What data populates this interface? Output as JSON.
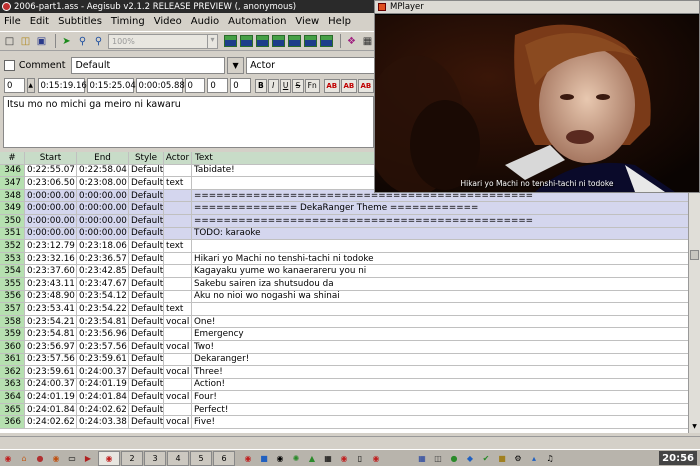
{
  "window": {
    "title": "2006-part1.ass - Aegisub v2.1.2 RELEASE PREVIEW (, anonymous)"
  },
  "menu": [
    "File",
    "Edit",
    "Subtitles",
    "Timing",
    "Video",
    "Audio",
    "Automation",
    "View",
    "Help"
  ],
  "toolbar": {
    "zoom_value": "100%"
  },
  "editor": {
    "comment_label": "Comment",
    "style_value": "Default",
    "actor_value": "Actor",
    "layer": "0",
    "start_time": "0:15:19.16",
    "end_time": "0:15:25.04",
    "duration": "0:00:05.88",
    "margin_l": "0",
    "margin_r": "0",
    "margin_v": "0",
    "fmt": {
      "bold": "B",
      "italic": "I",
      "underline": "U",
      "strike": "S",
      "font": "Fn",
      "c1": "AB",
      "c2": "AB",
      "c3": "AB"
    },
    "text": "Itsu mo no michi ga meiro ni kawaru"
  },
  "grid": {
    "headers": {
      "num": "#",
      "start": "Start",
      "end": "End",
      "style": "Style",
      "actor": "Actor",
      "text": "Text"
    },
    "rows": [
      {
        "num": "346",
        "start": "0:22:55.07",
        "end": "0:22:58.04",
        "style": "Default",
        "actor": "",
        "text": "Tabidate!",
        "comment": false
      },
      {
        "num": "347",
        "start": "0:23:06.50",
        "end": "0:23:08.00",
        "style": "Default",
        "actor": "text",
        "text": "",
        "comment": false
      },
      {
        "num": "348",
        "start": "0:00:00.00",
        "end": "0:00:00.00",
        "style": "Default",
        "actor": "",
        "text": "==============================================",
        "comment": true
      },
      {
        "num": "349",
        "start": "0:00:00.00",
        "end": "0:00:00.00",
        "style": "Default",
        "actor": "",
        "text": "============== DekaRanger Theme ============",
        "comment": true
      },
      {
        "num": "350",
        "start": "0:00:00.00",
        "end": "0:00:00.00",
        "style": "Default",
        "actor": "",
        "text": "==============================================",
        "comment": true
      },
      {
        "num": "351",
        "start": "0:00:00.00",
        "end": "0:00:00.00",
        "style": "Default",
        "actor": "",
        "text": "TODO: karaoke",
        "comment": true
      },
      {
        "num": "352",
        "start": "0:23:12.79",
        "end": "0:23:18.06",
        "style": "Default",
        "actor": "text",
        "text": "",
        "comment": false
      },
      {
        "num": "353",
        "start": "0:23:32.16",
        "end": "0:23:36.57",
        "style": "Default",
        "actor": "",
        "text": "Hikari yo Machi no tenshi-tachi ni todoke",
        "comment": false
      },
      {
        "num": "354",
        "start": "0:23:37.60",
        "end": "0:23:42.85",
        "style": "Default",
        "actor": "",
        "text": "Kagayaku yume wo kanaerareru you ni",
        "comment": false
      },
      {
        "num": "355",
        "start": "0:23:43.11",
        "end": "0:23:47.67",
        "style": "Default",
        "actor": "",
        "text": "Sakebu sairen iza shutsudou da",
        "comment": false
      },
      {
        "num": "356",
        "start": "0:23:48.90",
        "end": "0:23:54.12",
        "style": "Default",
        "actor": "",
        "text": "Aku no nioi wo nogashi wa shinai",
        "comment": false
      },
      {
        "num": "357",
        "start": "0:23:53.41",
        "end": "0:23:54.22",
        "style": "Default",
        "actor": "text",
        "text": "",
        "comment": false
      },
      {
        "num": "358",
        "start": "0:23:54.21",
        "end": "0:23:54.81",
        "style": "Default",
        "actor": "vocal",
        "text": "One!",
        "comment": false
      },
      {
        "num": "359",
        "start": "0:23:54.81",
        "end": "0:23:56.96",
        "style": "Default",
        "actor": "",
        "text": "Emergency",
        "comment": false
      },
      {
        "num": "360",
        "start": "0:23:56.97",
        "end": "0:23:57.56",
        "style": "Default",
        "actor": "vocal",
        "text": "Two!",
        "comment": false
      },
      {
        "num": "361",
        "start": "0:23:57.56",
        "end": "0:23:59.61",
        "style": "Default",
        "actor": "",
        "text": "Dekaranger!",
        "comment": false
      },
      {
        "num": "362",
        "start": "0:23:59.61",
        "end": "0:24:00.37",
        "style": "Default",
        "actor": "vocal",
        "text": "Three!",
        "comment": false
      },
      {
        "num": "363",
        "start": "0:24:00.37",
        "end": "0:24:01.19",
        "style": "Default",
        "actor": "",
        "text": "Action!",
        "comment": false
      },
      {
        "num": "364",
        "start": "0:24:01.19",
        "end": "0:24:01.84",
        "style": "Default",
        "actor": "vocal",
        "text": "Four!",
        "comment": false
      },
      {
        "num": "365",
        "start": "0:24:01.84",
        "end": "0:24:02.62",
        "style": "Default",
        "actor": "",
        "text": "Perfect!",
        "comment": false
      },
      {
        "num": "366",
        "start": "0:24:02.62",
        "end": "0:24:03.38",
        "style": "Default",
        "actor": "vocal",
        "text": "Five!",
        "comment": false
      }
    ]
  },
  "mplayer": {
    "title": "MPlayer",
    "subtitle": "Hikari yo Machi no tenshi-tachi ni todoke"
  },
  "taskbar": {
    "desktops": [
      "2",
      "3",
      "4",
      "5",
      "6"
    ],
    "clock": "20:56"
  },
  "colors": {
    "grid_header": "#c8dcc8",
    "num_cell": "#b6e0b0",
    "comment_row": "#d4d6ee"
  }
}
